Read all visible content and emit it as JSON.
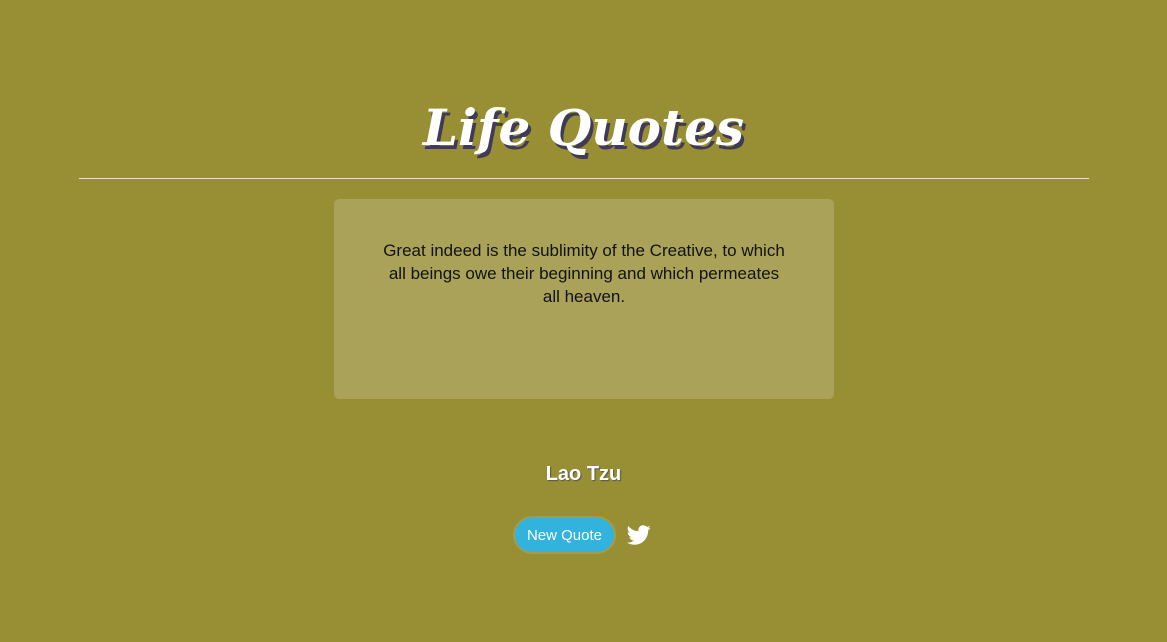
{
  "header": {
    "title": "Life Quotes"
  },
  "quote": {
    "text": "Great indeed is the sublimity of the Creative, to which all beings owe their beginning and which permeates all heaven.",
    "author": "Lao Tzu"
  },
  "actions": {
    "new_quote_label": "New Quote",
    "share_icon": "twitter-icon"
  },
  "colors": {
    "background": "#988e34",
    "button": "#32b3dd",
    "title_shadow": "#3f3a55"
  }
}
